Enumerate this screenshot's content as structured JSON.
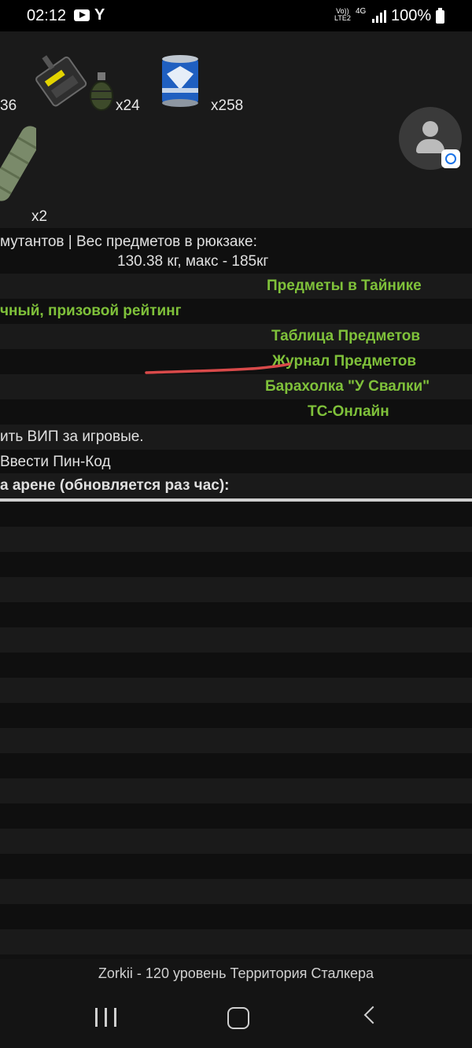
{
  "status_bar": {
    "time": "02:12",
    "y_icon": "Y",
    "volte_line1": "Vo))",
    "volte_line2": "LTE2",
    "network": "4G",
    "battery": "100%"
  },
  "inventory": {
    "count_1": "36",
    "count_2": "x24",
    "count_3": "x258",
    "count_4": "x2"
  },
  "info": {
    "weight_line1": "мутантов | Вес предметов в рюкзаке:",
    "weight_line2": "130.38 кг, макс - 185кг"
  },
  "links": {
    "stash": "Предметы в Тайнике",
    "rating": "чный, призовой рейтинг",
    "table": "Таблица Предметов",
    "journal": "Журнал Предметов",
    "market": "Барахолка \"У Свалки\"",
    "ts_online": "ТС-Онлайн"
  },
  "vip": {
    "buy_vip": "ить ВИП за игровые.",
    "pin_code": "Ввести Пин-Код"
  },
  "arena_header": "а арене (обновляется раз час):",
  "footer": {
    "caption": "Zorkii - 120 уровень Территория Сталкера"
  },
  "colors": {
    "link_green": "#7fc13a",
    "annotation_red": "#d94a4a"
  },
  "icons": [
    "youtube-icon",
    "avatar-icon",
    "sync-badge-icon",
    "recent-apps-icon",
    "home-icon",
    "back-icon"
  ]
}
